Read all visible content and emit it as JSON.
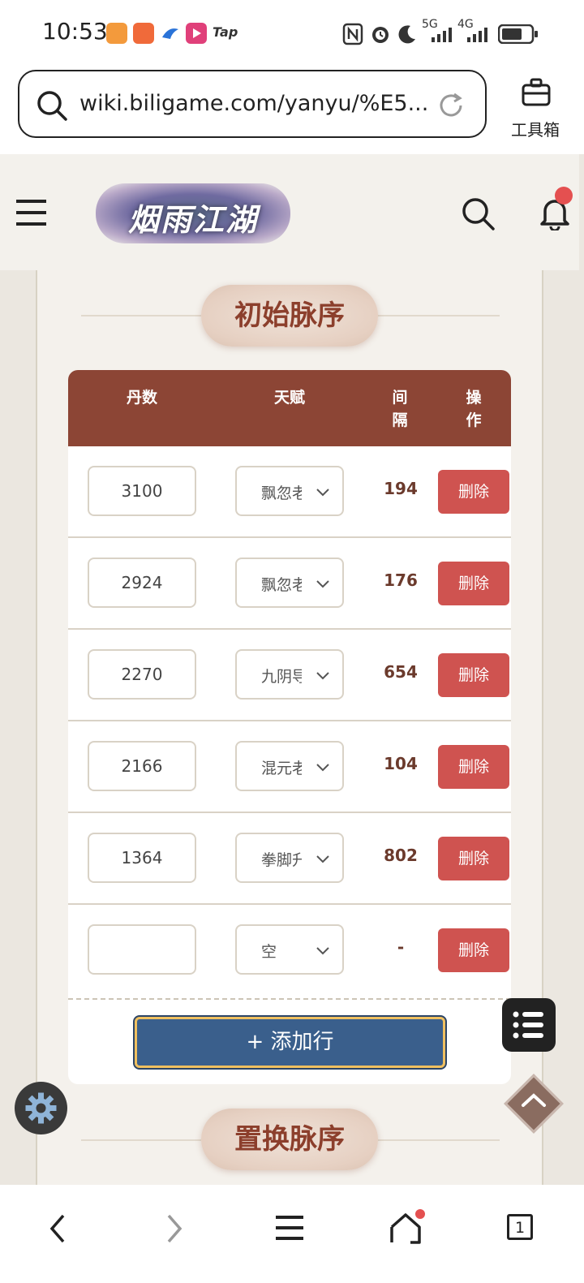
{
  "status_bar": {
    "time": "10:53",
    "app_label_tap": "Tap",
    "network_5g": "5G",
    "network_4g": "4G"
  },
  "browser": {
    "url": "wiki.biligame.com/yanyu/%E5...",
    "toolbox_label": "工具箱",
    "tab_count": "1"
  },
  "site": {
    "logo_text": "烟雨江湖"
  },
  "section1": {
    "title": "初始脉序",
    "headers": {
      "dan": "丹数",
      "talent": "天赋",
      "gap": "间隔",
      "action": "操作"
    },
    "rows": [
      {
        "dan": "3100",
        "talent": "飘忽老",
        "gap": "194",
        "action": "删除"
      },
      {
        "dan": "2924",
        "talent": "飘忽老",
        "gap": "176",
        "action": "删除"
      },
      {
        "dan": "2270",
        "talent": "九阴导",
        "gap": "654",
        "action": "删除"
      },
      {
        "dan": "2166",
        "talent": "混元老",
        "gap": "104",
        "action": "删除"
      },
      {
        "dan": "1364",
        "talent": "拳脚升",
        "gap": "802",
        "action": "删除"
      },
      {
        "dan": "",
        "talent": "空",
        "gap": "-",
        "action": "删除"
      }
    ],
    "add_row_label": "+ 添加行"
  },
  "section2": {
    "title": "置换脉序"
  },
  "colors": {
    "header_brown": "#8c4535",
    "delete_red": "#cf5350",
    "add_button_blue": "#3a5f8c",
    "title_text": "#8c3f2c"
  }
}
